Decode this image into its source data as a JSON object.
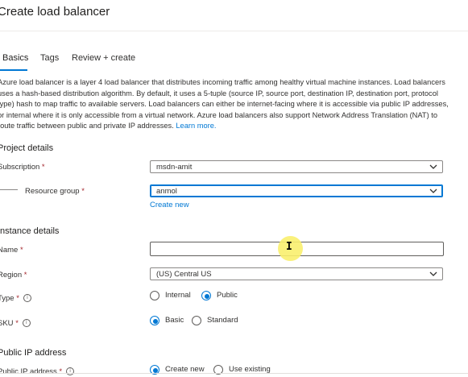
{
  "page": {
    "title": "Create load balancer"
  },
  "tabs": [
    {
      "label": "Basics",
      "active": true
    },
    {
      "label": "Tags",
      "active": false
    },
    {
      "label": "Review + create",
      "active": false
    }
  ],
  "description": {
    "text": "Azure load balancer is a layer 4 load balancer that distributes incoming traffic among healthy virtual machine instances. Load balancers uses a hash-based distribution algorithm. By default, it uses a 5-tuple (source IP, source port, destination IP, destination port, protocol type) hash to map traffic to available servers. Load balancers can either be internet-facing where it is accessible via public IP addresses, or internal where it is only accessible from a virtual network. Azure load balancers also support Network Address Translation (NAT) to route traffic between public and private IP addresses.",
    "learn_more": "Learn more."
  },
  "project_details": {
    "heading": "Project details",
    "subscription": {
      "label": "Subscription",
      "value": "msdn-amit"
    },
    "resource_group": {
      "label": "Resource group",
      "value": "anmol",
      "create_new": "Create new"
    }
  },
  "instance_details": {
    "heading": "Instance details",
    "name": {
      "label": "Name",
      "value": ""
    },
    "region": {
      "label": "Region",
      "value": "(US) Central US"
    },
    "type": {
      "label": "Type",
      "options": [
        "Internal",
        "Public"
      ],
      "selected": "Public"
    },
    "sku": {
      "label": "SKU",
      "options": [
        "Basic",
        "Standard"
      ],
      "selected": "Basic"
    }
  },
  "public_ip": {
    "heading": "Public IP address",
    "label": "Public IP address",
    "options": [
      "Create new",
      "Use existing"
    ],
    "selected": "Create new"
  },
  "required_marker": "*",
  "icons": {
    "info": "info-icon",
    "chevron": "chevron-down-icon",
    "cursor": "text-cursor-icon"
  },
  "colors": {
    "accent": "#0078d4",
    "required": "#a4262c",
    "cursor_highlight": "#faf06e"
  }
}
